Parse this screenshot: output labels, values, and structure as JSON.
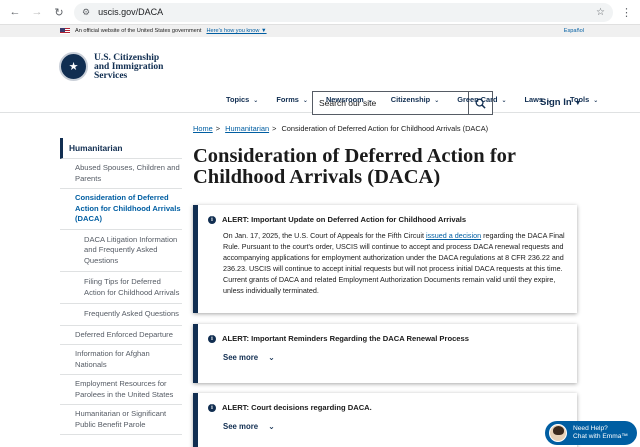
{
  "browser": {
    "url": "uscis.gov/DACA"
  },
  "gov_banner": {
    "text": "An official website of the United States government",
    "link": "Here's how you know",
    "spanish": "Español"
  },
  "header": {
    "logo_line1": "U.S. Citizenship",
    "logo_line2": "and Immigration",
    "logo_line3": "Services",
    "search_placeholder": "Search our site",
    "signin": "Sign In"
  },
  "nav": [
    "Topics",
    "Forms",
    "Newsroom",
    "Citizenship",
    "Green Card",
    "Laws",
    "Tools"
  ],
  "sidebar": {
    "heading": "Humanitarian",
    "items": [
      {
        "label": "Abused Spouses, Children and Parents"
      },
      {
        "label": "Consideration of Deferred Action for Childhood Arrivals (DACA)"
      },
      {
        "label": "DACA Litigation Information and Frequently Asked Questions"
      },
      {
        "label": "Filing Tips for Deferred Action for Childhood Arrivals"
      },
      {
        "label": "Frequently Asked Questions"
      },
      {
        "label": "Deferred Enforced Departure"
      },
      {
        "label": "Information for Afghan Nationals"
      },
      {
        "label": "Employment Resources for Parolees in the United States"
      },
      {
        "label": "Humanitarian or Significant Public Benefit Parole"
      }
    ]
  },
  "breadcrumb": {
    "home": "Home",
    "humanitarian": "Humanitarian",
    "current": "Consideration of Deferred Action for Childhood Arrivals (DACA)"
  },
  "page": {
    "title": "Consideration of Deferred Action for Childhood Arrivals (DACA)"
  },
  "alerts": [
    {
      "heading": "ALERT: Important Update on Deferred Action for Childhood Arrivals",
      "body_before": "On Jan. 17, 2025, the U.S. Court of Appeals for the Fifth Circuit ",
      "body_link": "issued a decision",
      "body_after": " regarding the DACA Final Rule. Pursuant to the court's order, USCIS will continue to accept and process DACA renewal requests and accompanying applications for employment authorization under the DACA regulations at 8 CFR 236.22 and 236.23. USCIS will continue to accept initial requests but will not process initial DACA requests at this time. Current grants of DACA and related Employment Authorization Documents remain valid until they expire, unless individually terminated."
    },
    {
      "heading": "ALERT: Important Reminders Regarding the DACA Renewal Process",
      "see_more": "See more"
    },
    {
      "heading": "ALERT: Court decisions regarding DACA.",
      "see_more": "See more"
    }
  ],
  "chat": {
    "line1": "Need Help?",
    "line2": "Chat with Emma™"
  }
}
